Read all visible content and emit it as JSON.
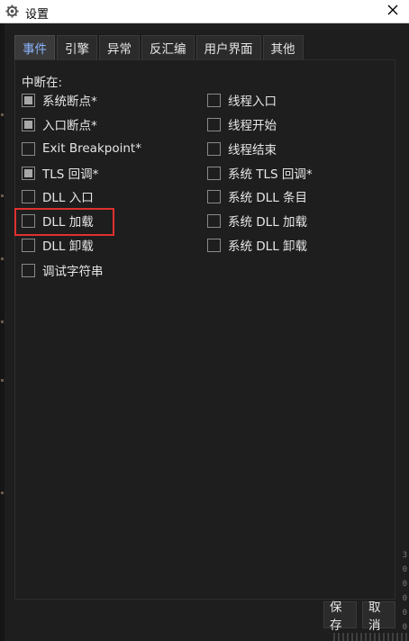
{
  "window": {
    "title": "设置",
    "icon": "gear-icon",
    "close_icon": "close-icon"
  },
  "tabs": [
    {
      "label": "事件",
      "active": true
    },
    {
      "label": "引擎",
      "active": false
    },
    {
      "label": "异常",
      "active": false
    },
    {
      "label": "反汇编",
      "active": false
    },
    {
      "label": "用户界面",
      "active": false
    },
    {
      "label": "其他",
      "active": false
    }
  ],
  "events": {
    "section_label": "中断在:",
    "left_column": [
      {
        "label": "系统断点*",
        "checked": true
      },
      {
        "label": "入口断点*",
        "checked": true
      },
      {
        "label": "Exit Breakpoint*",
        "checked": false
      },
      {
        "label": "TLS 回调*",
        "checked": true
      },
      {
        "label": "DLL 入口",
        "checked": false
      },
      {
        "label": "DLL 加载",
        "checked": false,
        "highlighted": true
      },
      {
        "label": "DLL 卸载",
        "checked": false
      },
      {
        "label": "调试字符串",
        "checked": false
      }
    ],
    "right_column": [
      {
        "label": "线程入口",
        "checked": false
      },
      {
        "label": "线程开始",
        "checked": false
      },
      {
        "label": "线程结束",
        "checked": false
      },
      {
        "label": "系统 TLS 回调*",
        "checked": false
      },
      {
        "label": "系统 DLL 条目",
        "checked": false
      },
      {
        "label": "系统 DLL 加载",
        "checked": false
      },
      {
        "label": "系统 DLL 卸载",
        "checked": false
      }
    ]
  },
  "footer": {
    "save_label": "保存",
    "cancel_label": "取消"
  },
  "colors": {
    "background": "#1e1e1e",
    "active_tab_text": "#8ab4ff",
    "highlight_border": "#e03030"
  }
}
